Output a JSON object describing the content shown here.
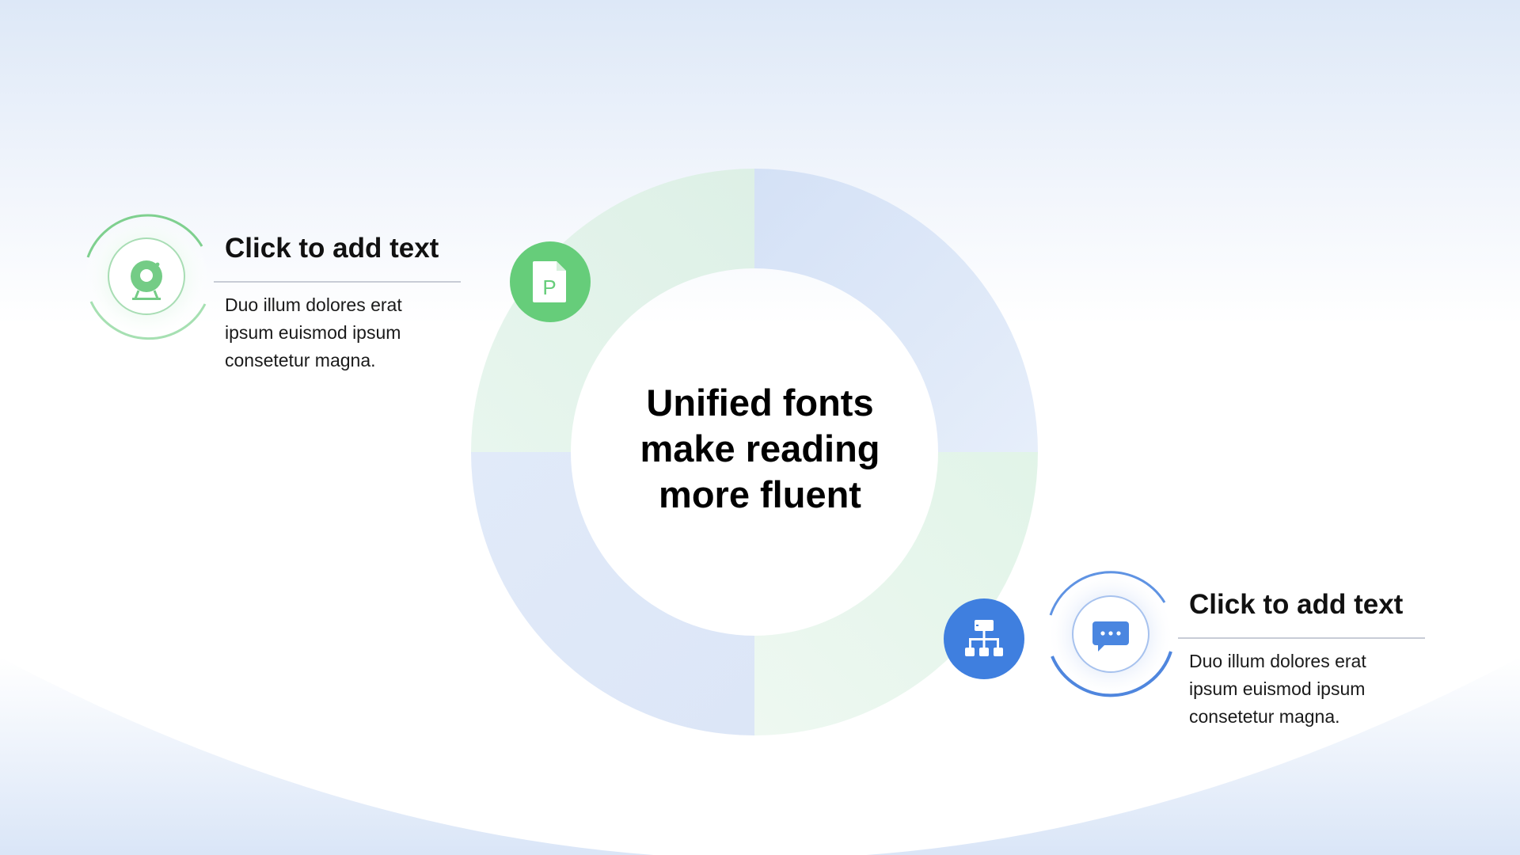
{
  "center": {
    "lines": [
      "Unified fonts",
      "make reading",
      "more fluent"
    ]
  },
  "items": [
    {
      "title": "Click to add text",
      "body": [
        "Duo illum dolores erat",
        "ipsum euismod ipsum",
        "consetetur magna."
      ],
      "icon": "webcam-icon",
      "color": "#66cd7a"
    },
    {
      "title": "Click to add text",
      "body": [
        "Duo illum dolores erat",
        "ipsum euismod ipsum",
        "consetetur magna."
      ],
      "icon": "chat-bubble-icon",
      "color": "#3f7fdf"
    }
  ],
  "badges": [
    {
      "icon": "document-p-icon",
      "letter": "P",
      "color": "#66cd7a"
    },
    {
      "icon": "org-chart-icon",
      "color": "#3f7fdf"
    }
  ],
  "colors": {
    "green": "#66cd7a",
    "blue": "#3f7fdf",
    "ring_green": "#e3f4ea",
    "ring_blue": "#dfe8f8"
  }
}
